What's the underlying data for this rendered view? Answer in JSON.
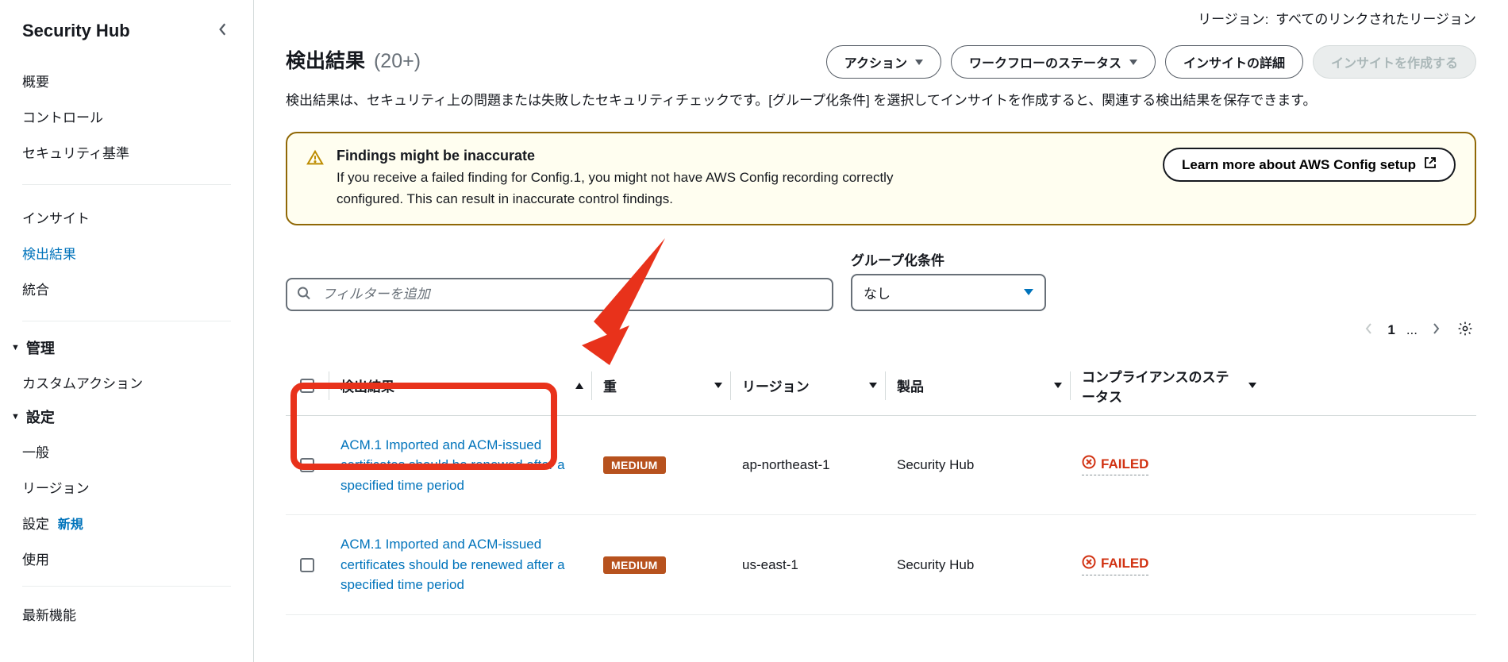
{
  "sidebar": {
    "title": "Security Hub",
    "items": [
      "概要",
      "コントロール",
      "セキュリティ基準"
    ],
    "items2": [
      "インサイト",
      "検出結果",
      "統合"
    ],
    "section_admin": "管理",
    "admin_items": [
      "カスタムアクション"
    ],
    "section_settings": "設定",
    "settings_items": [
      {
        "label": "一般"
      },
      {
        "label": "リージョン"
      },
      {
        "label": "設定",
        "badge": "新規"
      },
      {
        "label": "使用"
      }
    ],
    "cutoff": "最新機能"
  },
  "region": {
    "label": "リージョン:",
    "value": "すべてのリンクされたリージョン"
  },
  "page": {
    "title": "検出結果",
    "count": "(20+)",
    "desc": "検出結果は、セキュリティ上の問題または失敗したセキュリティチェックです。[グループ化条件] を選択してインサイトを作成すると、関連する検出結果を保存できます。"
  },
  "buttons": {
    "action": "アクション",
    "workflow": "ワークフローのステータス",
    "insight_detail": "インサイトの詳細",
    "insight_create": "インサイトを作成する"
  },
  "alert": {
    "title": "Findings might be inaccurate",
    "body": "If you receive a failed finding for Config.1, you might not have AWS Config recording correctly configured. This can result in inaccurate control findings.",
    "cta": "Learn more about AWS Config setup"
  },
  "filter": {
    "placeholder": "フィルターを追加"
  },
  "group": {
    "label": "グループ化条件",
    "value": "なし"
  },
  "pager": {
    "page": "1",
    "dots": "..."
  },
  "columns": {
    "title": "検出結果",
    "severity": "重",
    "region": "リージョン",
    "product": "製品",
    "compliance": "コンプライアンスのステータス"
  },
  "rows": [
    {
      "title": "ACM.1 Imported and ACM-issued certificates should be renewed after a specified time period",
      "severity": "MEDIUM",
      "region": "ap-northeast-1",
      "product": "Security Hub",
      "compliance": "FAILED"
    },
    {
      "title": "ACM.1 Imported and ACM-issued certificates should be renewed after a specified time period",
      "severity": "MEDIUM",
      "region": "us-east-1",
      "product": "Security Hub",
      "compliance": "FAILED"
    }
  ]
}
